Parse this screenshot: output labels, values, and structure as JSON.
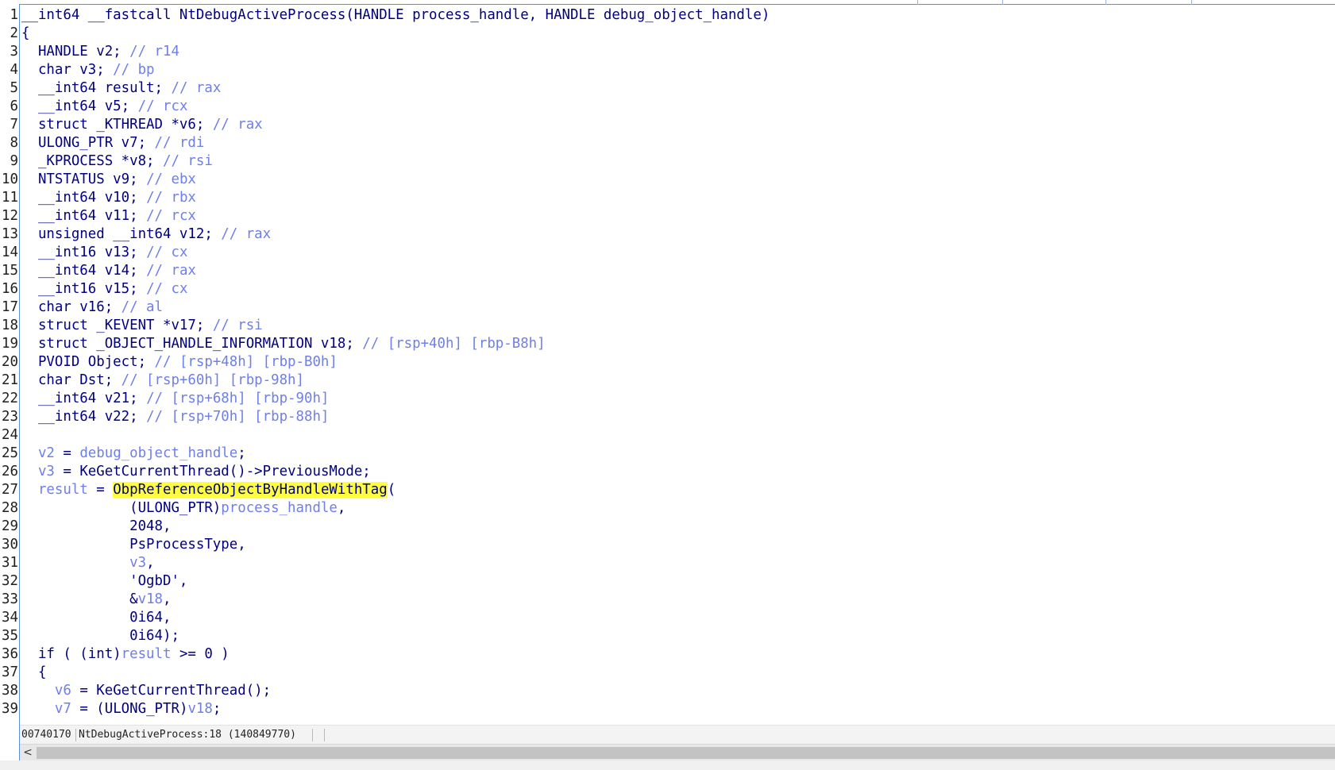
{
  "window": {
    "status_address": "00740170",
    "status_location": "NtDebugActiveProcess:18 (140849770)",
    "scroll_left_glyph": "<"
  },
  "colors": {
    "keyword": "#000080",
    "type_gray": "#6f6f6f",
    "comment_blue": "#6f7fe8",
    "highlight": "#ffff40",
    "border": "#5b8fd6"
  },
  "code": {
    "lines": [
      {
        "n": "1",
        "t": "__int64 __fastcall NtDebugActiveProcess(HANDLE process_handle, HANDLE debug_object_handle)"
      },
      {
        "n": "2",
        "t": "{"
      },
      {
        "n": "3",
        "t": "  HANDLE v2; // r14"
      },
      {
        "n": "4",
        "t": "  char v3; // bp"
      },
      {
        "n": "5",
        "t": "  __int64 result; // rax"
      },
      {
        "n": "6",
        "t": "  __int64 v5; // rcx"
      },
      {
        "n": "7",
        "t": "  struct _KTHREAD *v6; // rax"
      },
      {
        "n": "8",
        "t": "  ULONG_PTR v7; // rdi"
      },
      {
        "n": "9",
        "t": "  _KPROCESS *v8; // rsi"
      },
      {
        "n": "10",
        "t": "  NTSTATUS v9; // ebx"
      },
      {
        "n": "11",
        "t": "  __int64 v10; // rbx"
      },
      {
        "n": "12",
        "t": "  __int64 v11; // rcx"
      },
      {
        "n": "13",
        "t": "  unsigned __int64 v12; // rax"
      },
      {
        "n": "14",
        "t": "  __int16 v13; // cx"
      },
      {
        "n": "15",
        "t": "  __int64 v14; // rax"
      },
      {
        "n": "16",
        "t": "  __int16 v15; // cx"
      },
      {
        "n": "17",
        "t": "  char v16; // al"
      },
      {
        "n": "18",
        "t": "  struct _KEVENT *v17; // rsi"
      },
      {
        "n": "19",
        "t": "  struct _OBJECT_HANDLE_INFORMATION v18; // [rsp+40h] [rbp-B8h]"
      },
      {
        "n": "20",
        "t": "  PVOID Object; // [rsp+48h] [rbp-B0h]"
      },
      {
        "n": "21",
        "t": "  char Dst; // [rsp+60h] [rbp-98h]"
      },
      {
        "n": "22",
        "t": "  __int64 v21; // [rsp+68h] [rbp-90h]"
      },
      {
        "n": "23",
        "t": "  __int64 v22; // [rsp+70h] [rbp-88h]"
      },
      {
        "n": "24",
        "t": ""
      },
      {
        "n": "25",
        "t": "  v2 = debug_object_handle;"
      },
      {
        "n": "26",
        "t": "  v3 = KeGetCurrentThread()->PreviousMode;"
      },
      {
        "n": "27",
        "t": "  result = ObpReferenceObjectByHandleWithTag("
      },
      {
        "n": "28",
        "t": "             (ULONG_PTR)process_handle,"
      },
      {
        "n": "29",
        "t": "             2048,"
      },
      {
        "n": "30",
        "t": "             PsProcessType,"
      },
      {
        "n": "31",
        "t": "             v3,"
      },
      {
        "n": "32",
        "t": "             'OgbD',"
      },
      {
        "n": "33",
        "t": "             &v18,"
      },
      {
        "n": "34",
        "t": "             0i64,"
      },
      {
        "n": "35",
        "t": "             0i64);"
      },
      {
        "n": "36",
        "t": "  if ( (int)result >= 0 )"
      },
      {
        "n": "37",
        "t": "  {"
      },
      {
        "n": "38",
        "t": "    v6 = KeGetCurrentThread();"
      },
      {
        "n": "39",
        "t": "    v7 = (ULONG_PTR)v18;"
      }
    ]
  }
}
